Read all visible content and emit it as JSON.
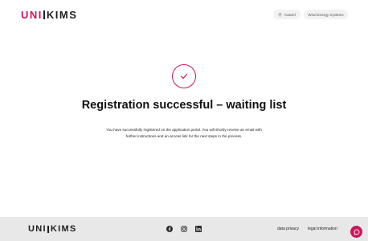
{
  "header": {
    "logo_left": "UNI",
    "logo_right": "KIMS",
    "location_chip": "Kassel",
    "company_chip": "Wind Energy Systems"
  },
  "main": {
    "title": "Registration successful – waiting list",
    "message": "You have successfully registered on the application portal. You will shortly receive an email with further instructions and an access link for the next steps in the process."
  },
  "footer": {
    "logo_left": "UNI",
    "logo_right": "KIMS",
    "links": [
      "data privacy",
      "legal information"
    ]
  },
  "icons": {
    "check": "check-icon",
    "location": "pin-icon",
    "social": [
      "facebook-icon",
      "instagram-icon",
      "linkedin-icon"
    ],
    "chat": "chat-icon"
  },
  "colors": {
    "accent": "#c8175d",
    "footer_bg": "#e8e8e8",
    "chip_bg": "#f2f2f2"
  }
}
